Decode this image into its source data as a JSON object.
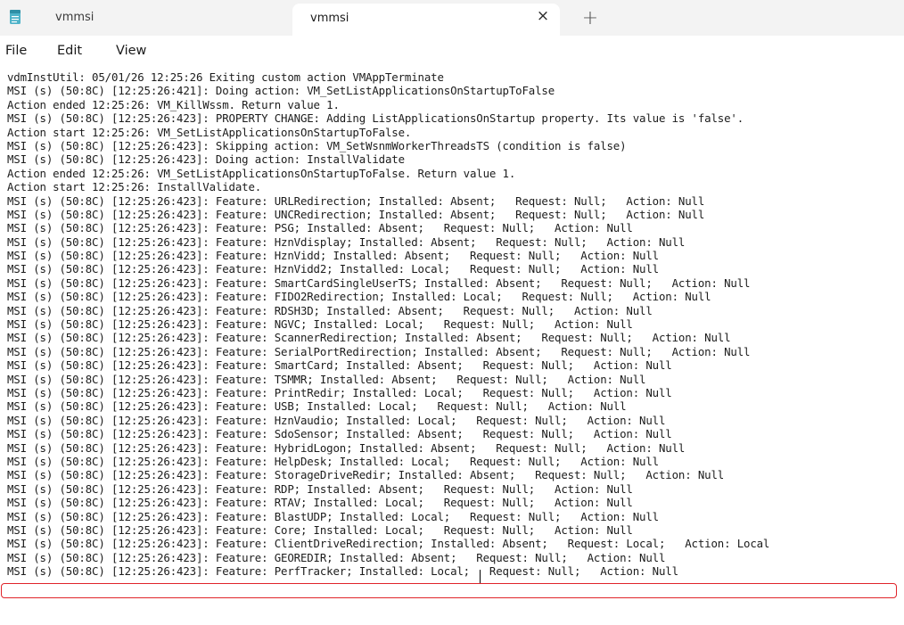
{
  "tabs": [
    {
      "label": "vmmsi",
      "active": false
    },
    {
      "label": "vmmsi",
      "active": true
    }
  ],
  "tab_close_glyph": "×",
  "new_tab_glyph": "+",
  "menu": {
    "file": "File",
    "edit": "Edit",
    "view": "View"
  },
  "colors": {
    "highlight": "#e0242a",
    "tabbar": "#f3f3f3",
    "notepad_icon": "#4fb3c9"
  },
  "icons": {
    "app": "notepad-icon",
    "close": "close-icon",
    "new_tab": "plus-icon"
  },
  "highlighted_line_index": 37,
  "lines": [
    "vdmInstUtil: 05/01/26 12:25:26 Exiting custom action VMAppTerminate",
    "MSI (s) (50:8C) [12:25:26:421]: Doing action: VM_SetListApplicationsOnStartupToFalse",
    "Action ended 12:25:26: VM_KillWssm. Return value 1.",
    "MSI (s) (50:8C) [12:25:26:423]: PROPERTY CHANGE: Adding ListApplicationsOnStartup property. Its value is 'false'.",
    "Action start 12:25:26: VM_SetListApplicationsOnStartupToFalse.",
    "MSI (s) (50:8C) [12:25:26:423]: Skipping action: VM_SetWsnmWorkerThreadsTS (condition is false)",
    "MSI (s) (50:8C) [12:25:26:423]: Doing action: InstallValidate",
    "Action ended 12:25:26: VM_SetListApplicationsOnStartupToFalse. Return value 1.",
    "Action start 12:25:26: InstallValidate.",
    "MSI (s) (50:8C) [12:25:26:423]: Feature: URLRedirection; Installed: Absent;   Request: Null;   Action: Null",
    "MSI (s) (50:8C) [12:25:26:423]: Feature: UNCRedirection; Installed: Absent;   Request: Null;   Action: Null",
    "MSI (s) (50:8C) [12:25:26:423]: Feature: PSG; Installed: Absent;   Request: Null;   Action: Null",
    "MSI (s) (50:8C) [12:25:26:423]: Feature: HznVdisplay; Installed: Absent;   Request: Null;   Action: Null",
    "MSI (s) (50:8C) [12:25:26:423]: Feature: HznVidd; Installed: Absent;   Request: Null;   Action: Null",
    "MSI (s) (50:8C) [12:25:26:423]: Feature: HznVidd2; Installed: Local;   Request: Null;   Action: Null",
    "MSI (s) (50:8C) [12:25:26:423]: Feature: SmartCardSingleUserTS; Installed: Absent;   Request: Null;   Action: Null",
    "MSI (s) (50:8C) [12:25:26:423]: Feature: FIDO2Redirection; Installed: Local;   Request: Null;   Action: Null",
    "MSI (s) (50:8C) [12:25:26:423]: Feature: RDSH3D; Installed: Absent;   Request: Null;   Action: Null",
    "MSI (s) (50:8C) [12:25:26:423]: Feature: NGVC; Installed: Local;   Request: Null;   Action: Null",
    "MSI (s) (50:8C) [12:25:26:423]: Feature: ScannerRedirection; Installed: Absent;   Request: Null;   Action: Null",
    "MSI (s) (50:8C) [12:25:26:423]: Feature: SerialPortRedirection; Installed: Absent;   Request: Null;   Action: Null",
    "MSI (s) (50:8C) [12:25:26:423]: Feature: SmartCard; Installed: Absent;   Request: Null;   Action: Null",
    "MSI (s) (50:8C) [12:25:26:423]: Feature: TSMMR; Installed: Absent;   Request: Null;   Action: Null",
    "MSI (s) (50:8C) [12:25:26:423]: Feature: PrintRedir; Installed: Local;   Request: Null;   Action: Null",
    "MSI (s) (50:8C) [12:25:26:423]: Feature: USB; Installed: Local;   Request: Null;   Action: Null",
    "MSI (s) (50:8C) [12:25:26:423]: Feature: HznVaudio; Installed: Local;   Request: Null;   Action: Null",
    "MSI (s) (50:8C) [12:25:26:423]: Feature: SdoSensor; Installed: Absent;   Request: Null;   Action: Null",
    "MSI (s) (50:8C) [12:25:26:423]: Feature: HybridLogon; Installed: Absent;   Request: Null;   Action: Null",
    "MSI (s) (50:8C) [12:25:26:423]: Feature: HelpDesk; Installed: Local;   Request: Null;   Action: Null",
    "MSI (s) (50:8C) [12:25:26:423]: Feature: StorageDriveRedir; Installed: Absent;   Request: Null;   Action: Null",
    "MSI (s) (50:8C) [12:25:26:423]: Feature: RDP; Installed: Absent;   Request: Null;   Action: Null",
    "MSI (s) (50:8C) [12:25:26:423]: Feature: RTAV; Installed: Local;   Request: Null;   Action: Null",
    "MSI (s) (50:8C) [12:25:26:423]: Feature: BlastUDP; Installed: Local;   Request: Null;   Action: Null",
    "MSI (s) (50:8C) [12:25:26:423]: Feature: Core; Installed: Local;   Request: Null;   Action: Null",
    "MSI (s) (50:8C) [12:25:26:423]: Feature: ClientDriveRedirection; Installed: Absent;   Request: Local;   Action: Local",
    "MSI (s) (50:8C) [12:25:26:423]: Feature: GEOREDIR; Installed: Absent;   Request: Null;   Action: Null",
    "MSI (s) (50:8C) [12:25:26:423]: Feature: PerfTracker; Installed: Local;   Request: Null;   Action: Null"
  ]
}
